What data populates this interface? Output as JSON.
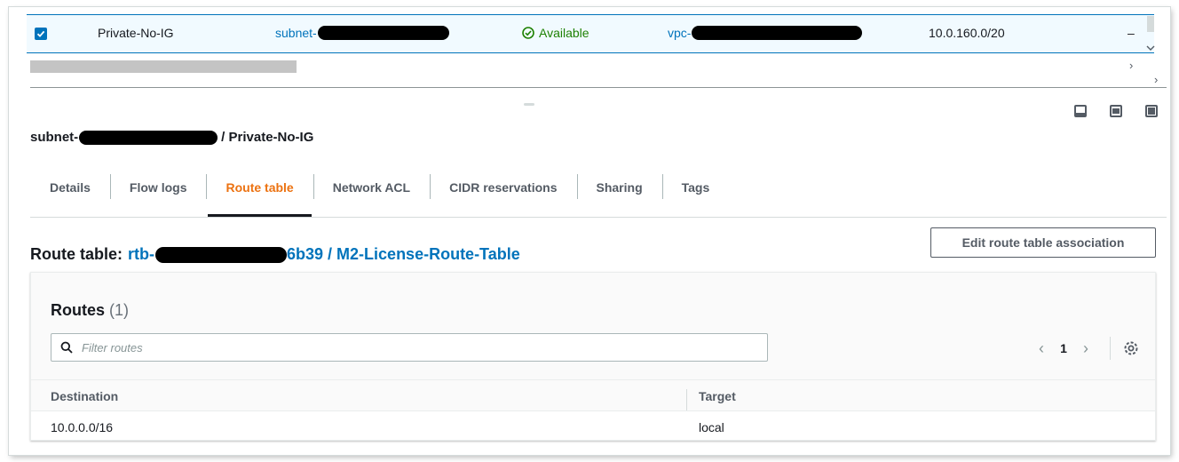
{
  "selected_row": {
    "name": "Private-No-IG",
    "subnet_prefix": "subnet-",
    "status": "Available",
    "vpc_prefix": "vpc-",
    "cidr": "10.0.160.0/20",
    "dash": "–"
  },
  "panel": {
    "subnet_prefix": "subnet-",
    "subnet_suffix": "/ Private-No-IG"
  },
  "tabs": [
    {
      "label": "Details"
    },
    {
      "label": "Flow logs"
    },
    {
      "label": "Route table",
      "active": true
    },
    {
      "label": "Network ACL"
    },
    {
      "label": "CIDR reservations"
    },
    {
      "label": "Sharing"
    },
    {
      "label": "Tags"
    }
  ],
  "route_table": {
    "label": "Route table:",
    "id_prefix": "rtb-",
    "id_suffix": "6b39 / M2-License-Route-Table",
    "edit_button": "Edit route table association"
  },
  "routes": {
    "title": "Routes",
    "count": "(1)",
    "filter_placeholder": "Filter routes",
    "page": "1",
    "columns": [
      "Destination",
      "Target"
    ],
    "rows": [
      {
        "destination": "10.0.0.0/16",
        "target": "local"
      }
    ]
  },
  "colors": {
    "link": "#0073bb",
    "active_tab": "#ec7211",
    "success": "#1d8102"
  }
}
